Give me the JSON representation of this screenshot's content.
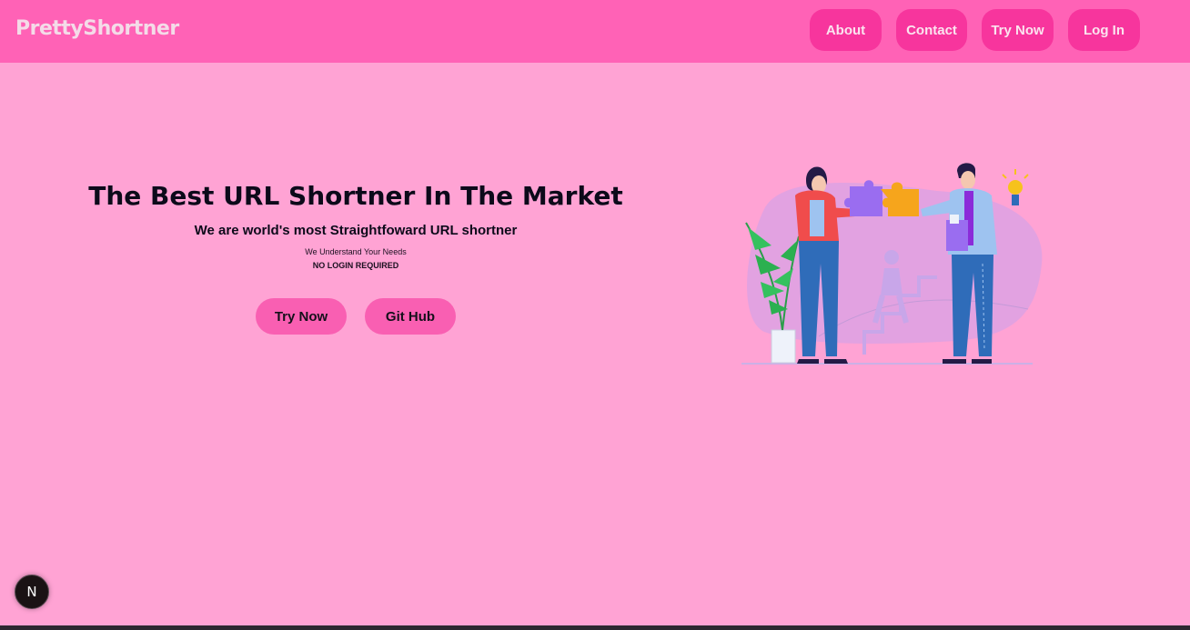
{
  "nav": {
    "brand": "PrettyShortner",
    "links": [
      {
        "label": "About"
      },
      {
        "label": "Contact"
      },
      {
        "label": "Try Now"
      },
      {
        "label": "Log In"
      }
    ]
  },
  "hero": {
    "title": "The Best URL Shortner In The Market",
    "subtitle": "We are world's most Straightfoward URL shortner",
    "tagline": "We Understand Your Needs",
    "note": "NO LOGIN REQUIRED",
    "buttons": {
      "try_now": "Try Now",
      "github": "Git Hub"
    }
  },
  "badge": {
    "letter": "N"
  },
  "colors": {
    "background": "#ffa3d4",
    "navbar": "#ff62b6",
    "nav_button": "#f7359d",
    "cta_button": "#f95fb2"
  }
}
